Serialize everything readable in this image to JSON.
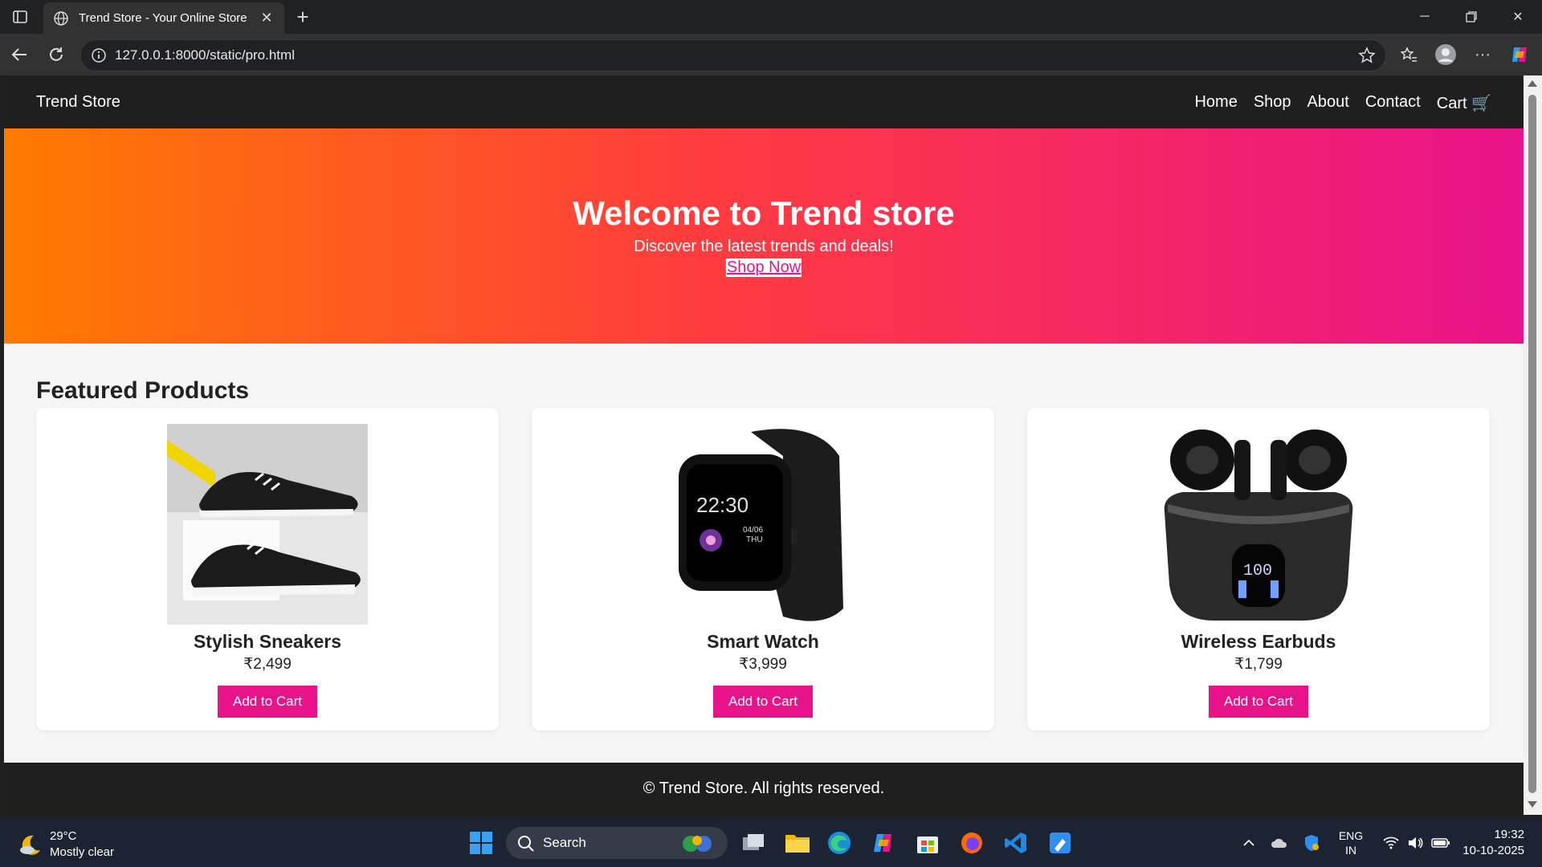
{
  "browser": {
    "tab_title": "Trend Store - Your Online Store",
    "url": "127.0.0.1:8000/static/pro.html"
  },
  "site": {
    "brand": "Trend Store",
    "nav": [
      "Home",
      "Shop",
      "About",
      "Contact",
      "Cart 🛒"
    ],
    "hero": {
      "title": "Welcome to Trend store",
      "subtitle": "Discover the latest trends and deals!",
      "cta": "Shop Now"
    },
    "featured_title": "Featured Products",
    "products": [
      {
        "name": "Stylish Sneakers",
        "price": "₹2,499",
        "button": "Add to Cart",
        "image": "sneakers-image"
      },
      {
        "name": "Smart Watch",
        "price": "₹3,999",
        "button": "Add to Cart",
        "image": "smartwatch-image"
      },
      {
        "name": "Wireless Earbuds",
        "price": "₹1,799",
        "button": "Add to Cart",
        "image": "earbuds-image"
      }
    ],
    "footer": "© Trend Store. All rights reserved."
  },
  "taskbar": {
    "weather_temp": "29°C",
    "weather_desc": "Mostly clear",
    "search_label": "Search",
    "lang_top": "ENG",
    "lang_bottom": "IN",
    "time": "19:32",
    "date": "10-10-2025"
  },
  "colors": {
    "accent": "#e8138a",
    "hero_start": "#ff7a00",
    "hero_end": "#e8138a",
    "header_bg": "#1f1f1f"
  }
}
